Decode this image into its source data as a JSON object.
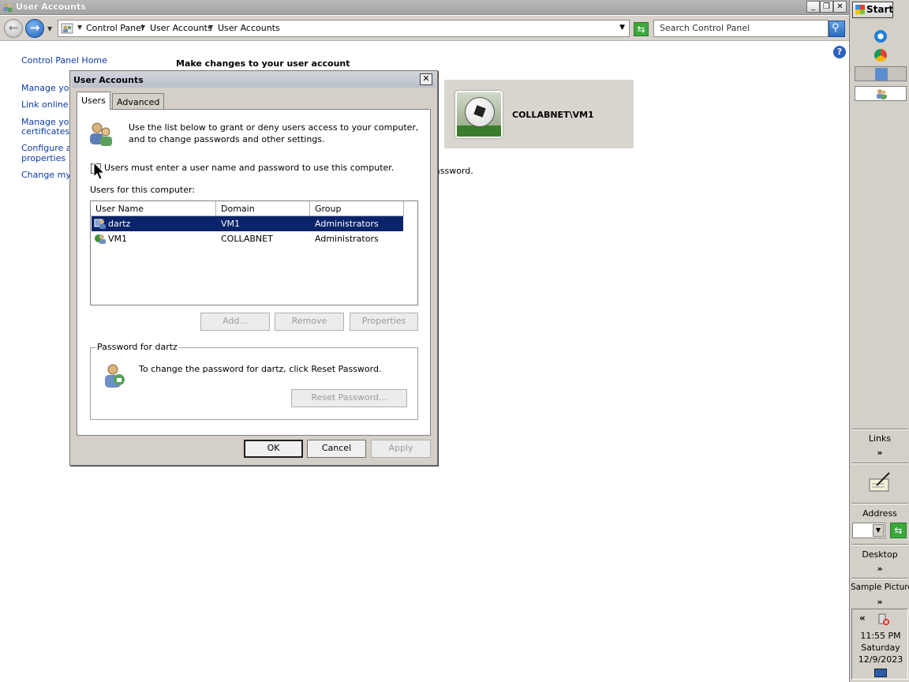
{
  "window": {
    "title": "User Accounts",
    "controls": [
      "minimize",
      "restore",
      "close"
    ]
  },
  "address_bar": {
    "breadcrumb": [
      "Control Panel",
      "User Accounts",
      "User Accounts"
    ],
    "search_placeholder": "Search Control Panel"
  },
  "left_nav": {
    "items": [
      "Control Panel Home",
      "Manage your",
      "Link online ID",
      "Manage your",
      "certificates",
      "Configure ac",
      "properties",
      "Change my e"
    ]
  },
  "main": {
    "heading": "Make changes to your user account",
    "account_name": "COLLABNET\\VM1",
    "fragment_text": "assword."
  },
  "dialog": {
    "title": "User Accounts",
    "tabs": [
      "Users",
      "Advanced"
    ],
    "active_tab": "Users",
    "intro": "Use the list below to grant or deny users access to your computer, and to change passwords and other settings.",
    "checkbox_label": "Users must enter a user name and password to use this computer.",
    "checkbox_checked": false,
    "users_label": "Users for this computer:",
    "columns": [
      "User Name",
      "Domain",
      "Group"
    ],
    "rows": [
      {
        "user": "dartz",
        "domain": "VM1",
        "group": "Administrators",
        "selected": true
      },
      {
        "user": "VM1",
        "domain": "COLLABNET",
        "group": "Administrators",
        "selected": false
      }
    ],
    "buttons": {
      "add": "Add...",
      "remove": "Remove",
      "properties": "Properties",
      "reset": "Reset Password...",
      "ok": "OK",
      "cancel": "Cancel",
      "apply": "Apply"
    },
    "password_group": {
      "legend": "Password for dartz",
      "text": "To change the password for dartz, click Reset Password."
    }
  },
  "sidebar": {
    "start": "Start",
    "links": "Links",
    "address": "Address",
    "desktop": "Desktop",
    "sample_pictures": "Sample Pictures",
    "chevron": "»",
    "tray_chevron": "«",
    "clock": {
      "time": "11:55 PM",
      "day": "Saturday",
      "date": "12/9/2023"
    }
  },
  "colors": {
    "selection": "#0a246a",
    "link": "#0b3aa6",
    "dialog_face": "#d4d0c8"
  }
}
